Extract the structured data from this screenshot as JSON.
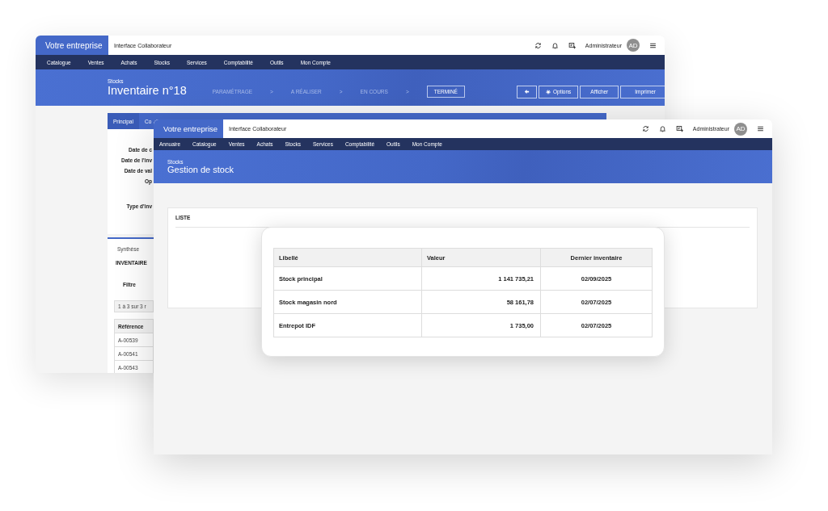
{
  "back_window": {
    "brand": "Votre entreprise",
    "title": "Interface Collaborateur",
    "user": {
      "name": "Administrateur",
      "initials": "AD"
    },
    "nav": [
      "Catalogue",
      "Ventes",
      "Achats",
      "Stocks",
      "Services",
      "Comptabilité",
      "Outils",
      "Mon Compte"
    ],
    "header": {
      "breadcrumb": "Stocks",
      "title": "Inventaire n°18",
      "steps": [
        {
          "label": "PARAMÉTRAGE",
          "selected": false
        },
        {
          "label": "A RÉALISER",
          "selected": false
        },
        {
          "label": "EN COURS",
          "selected": false
        },
        {
          "label": "TERMINÉ",
          "selected": true
        }
      ],
      "separators": [
        ">",
        ">",
        ">"
      ],
      "buttons": [
        {
          "kind": "icon"
        },
        {
          "kind": "gear",
          "label": "Options"
        },
        {
          "kind": "plain",
          "label": "Afficher"
        },
        {
          "kind": "plain",
          "label": "Imprimer"
        }
      ]
    },
    "tabs": [
      {
        "label": "Principal",
        "selected": true
      },
      {
        "label": "Co",
        "selected": false
      }
    ],
    "fields": [
      "Date de c",
      "Date de l'inv",
      "Date de val",
      "Op",
      "Type d'inv"
    ],
    "lower_tabs": [
      {
        "label": "Synthèse",
        "selected": true
      }
    ],
    "section_title": "INVENTAIRE",
    "filter_label": "Filtre",
    "pagination": "1 à 3 sur 3 r",
    "table": {
      "column": "Référence",
      "rows": [
        "A-00539",
        "A-00541",
        "A-00543"
      ]
    }
  },
  "front_window": {
    "brand": "Votre entreprise",
    "title": "Interface Collaborateur",
    "user": {
      "name": "Administrateur",
      "initials": "AD"
    },
    "nav": [
      "Annuaire",
      "Catalogue",
      "Ventes",
      "Achats",
      "Stocks",
      "Services",
      "Comptabilité",
      "Outils",
      "Mon Compte"
    ],
    "header": {
      "breadcrumb": "Stocks",
      "title": "Gestion de stock"
    },
    "card_title": "LISTE",
    "table": {
      "columns": [
        "Libellé",
        "Valeur",
        "Dernier inventaire"
      ],
      "rows": [
        {
          "label": "Stock principal",
          "value": "1 141 735,21",
          "date": "02/09/2025"
        },
        {
          "label": "Stock magasin nord",
          "value": "58 161,78",
          "date": "02/07/2025"
        },
        {
          "label": "Entrepot IDF",
          "value": "1 735,00",
          "date": "02/07/2025"
        }
      ]
    }
  }
}
